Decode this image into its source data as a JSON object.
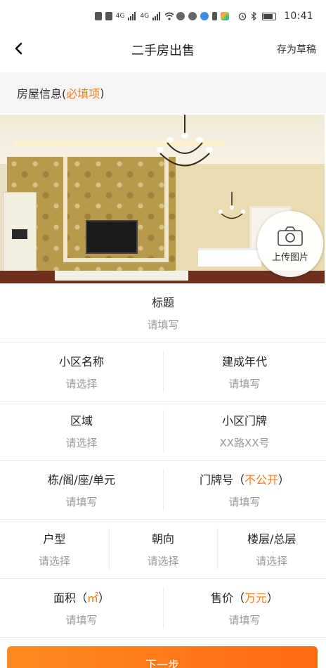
{
  "status_bar": {
    "time": "10:41",
    "signal_1": "4G",
    "signal_2": "4G"
  },
  "nav": {
    "title": "二手房出售",
    "draft": "存为草稿"
  },
  "section": {
    "title_prefix": "房屋信息(",
    "required": "必填项",
    "title_suffix": ")"
  },
  "photo": {
    "upload_label": "上传图片"
  },
  "form": {
    "title": {
      "label": "标题",
      "placeholder": "请填写"
    },
    "community_name": {
      "label": "小区名称",
      "placeholder": "请选择"
    },
    "build_year": {
      "label": "建成年代",
      "placeholder": "请填写"
    },
    "area_region": {
      "label": "区域",
      "placeholder": "请选择"
    },
    "community_plate": {
      "label": "小区门牌",
      "placeholder": "XX路XX号"
    },
    "building_unit": {
      "label": "栋/阁/座/单元",
      "placeholder": "请填写"
    },
    "door_number": {
      "label": "门牌号（",
      "label_note": "不公开",
      "label_end": "）",
      "placeholder": "请填写"
    },
    "layout": {
      "label": "户型",
      "placeholder": "请选择"
    },
    "orientation": {
      "label": "朝向",
      "placeholder": "请选择"
    },
    "floor": {
      "label": "楼层/总层",
      "placeholder": "请选择"
    },
    "size": {
      "label": "面积（",
      "label_note": "㎡",
      "label_end": "）",
      "placeholder": "请填写"
    },
    "price": {
      "label": "售价（",
      "label_note": "万元",
      "label_end": "）",
      "placeholder": "请填写"
    }
  },
  "footer": {
    "next": "下一步"
  },
  "colors": {
    "accent": "#ff7a1a",
    "placeholder": "#9a9a9a",
    "section_bg": "#f5f5f5"
  }
}
